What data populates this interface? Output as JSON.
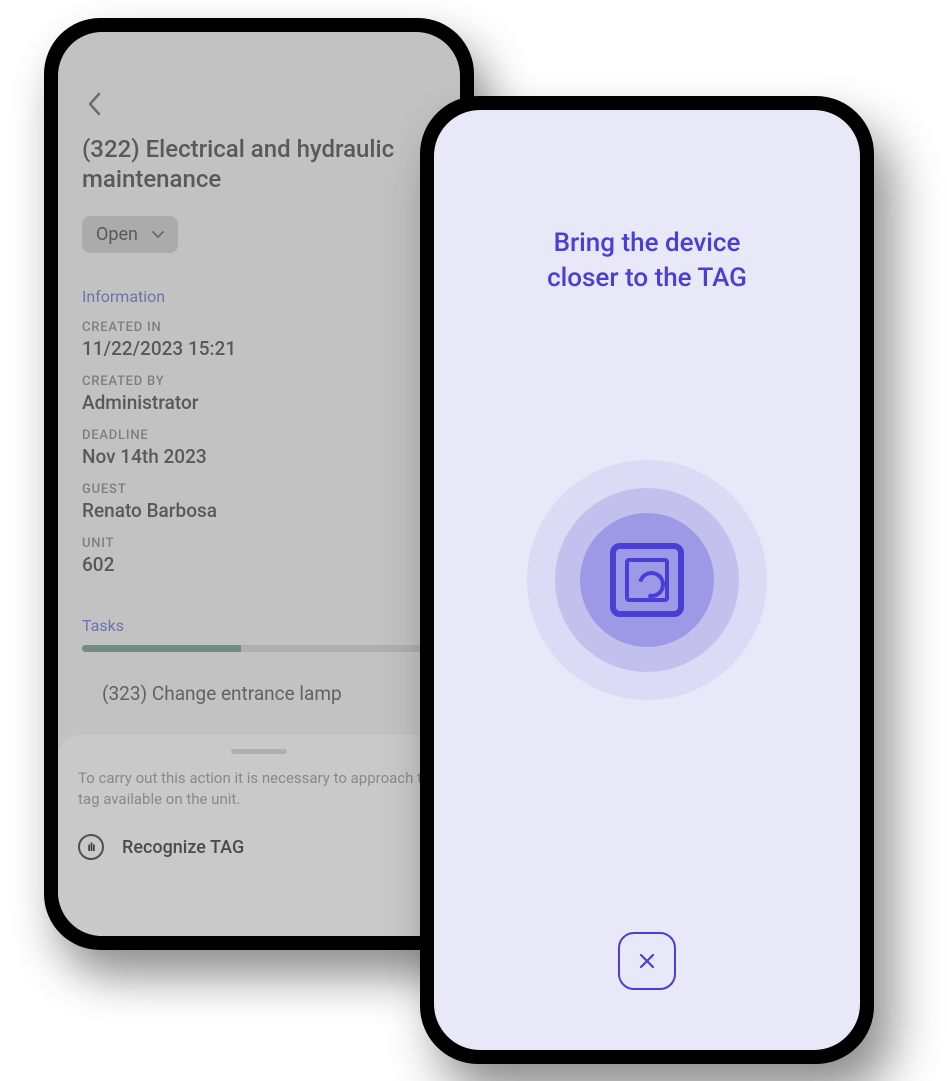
{
  "phone1": {
    "title": "(322) Electrical and hydraulic maintenance",
    "status": "Open",
    "section_info_label": "Information",
    "fields": {
      "created_in_label": "CREATED IN",
      "created_in": "11/22/2023 15:21",
      "created_by_label": "CREATED BY",
      "created_by": "Administrator",
      "deadline_label": "DEADLINE",
      "deadline": "Nov 14th 2023",
      "guest_label": "GUEST",
      "guest": "Renato Barbosa",
      "unit_label": "UNIT",
      "unit": "602"
    },
    "tasks_label": "Tasks",
    "tasks_progress_percent": 45,
    "task_item": "(323) Change entrance lamp",
    "sheet_text": "To carry out this action it is necessary to approach the tag available on the unit.",
    "sheet_action": "Recognize TAG"
  },
  "phone2": {
    "title_line1": "Bring the device",
    "title_line2": "closer to the TAG"
  }
}
